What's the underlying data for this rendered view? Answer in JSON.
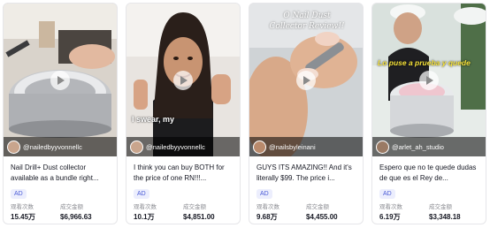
{
  "cards": [
    {
      "author": "@nailedbyyvonnellc",
      "title": "Nail Drill+ Dust collector available as a bundle right...",
      "ad": "AD",
      "views_label": "观看次数",
      "views": "15.45万",
      "gmv_label": "成交金额",
      "gmv": "$6,966.63",
      "overlay": ""
    },
    {
      "author": "@nailedbyyvonnellc",
      "title": "I think you can buy BOTH for the price of one RN!!!...",
      "ad": "AD",
      "views_label": "观看次数",
      "views": "10.1万",
      "gmv_label": "成交金额",
      "gmv": "$4,851.00",
      "overlay": "I swear, my"
    },
    {
      "author": "@nailsbyleinani",
      "title": "GUYS ITS AMAZING!! And it's literally $99. The price i...",
      "ad": "AD",
      "views_label": "观看次数",
      "views": "9.68万",
      "gmv_label": "成交金额",
      "gmv": "$4,455.00",
      "overlay": "O Nail Dust Collector Review!!"
    },
    {
      "author": "@arlet_ah_studio",
      "title": "Espero que no te quede dudas de que es el Rey de...",
      "ad": "AD",
      "views_label": "观看次数",
      "views": "6.19万",
      "gmv_label": "成交金额",
      "gmv": "$3,348.18",
      "overlay": "Lo puse a prueba y quede"
    }
  ]
}
